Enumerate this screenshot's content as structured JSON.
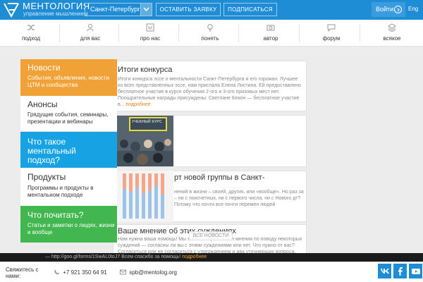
{
  "header": {
    "brand": "МЕНТОЛОГИЯ",
    "tagline": "управление мышлением",
    "city": "Санкт-Петербург",
    "apply_label": "ОСТАВИТЬ ЗАЯВКУ",
    "subscribe_label": "ПОДПИСАТЬСЯ",
    "login_label": "Войти",
    "lang_label": "Eng"
  },
  "nav": {
    "items": [
      {
        "label": "подход",
        "icon": "shuffle-icon"
      },
      {
        "label": "для вас",
        "icon": "person-icon"
      },
      {
        "label": "про нас",
        "icon": "m-box-icon"
      },
      {
        "label": "понять",
        "icon": "lightbulb-icon"
      },
      {
        "label": "автор",
        "icon": "camera-icon"
      },
      {
        "label": "форум",
        "icon": "chat-icon"
      },
      {
        "label": "всякое",
        "icon": "layers-icon"
      }
    ]
  },
  "menu": {
    "items": [
      {
        "title": "Новости",
        "subtitle": "События, объявления, новости ЦТМ и сообщества",
        "color": "#f0a236"
      },
      {
        "title": "Анонсы",
        "subtitle": "Грядущие события, семинары, презентации и вебинары",
        "color": "#ffffff"
      },
      {
        "title": "Что такое ментальный подход?",
        "subtitle": "",
        "color": "#17a3e3"
      },
      {
        "title": "Продукты",
        "subtitle": "Программы и продукты в ментальном подходе",
        "color": "#ffffff"
      },
      {
        "title": "Что почитать?",
        "subtitle": "Статьи и заметки о людях, жизни и вообще",
        "color": "#43b74f"
      }
    ]
  },
  "news": [
    {
      "title": "Итоги конкурса",
      "text": "Итоги конкурса эссе о ментальности Санкт-Петербурга и его горожан. Лучшее из всех представленных эссе, нам прислала Елена Листина. Ей предоставлено бесплатное участие в курсе обучения 2-ого и 3-ого призовых мест нет. Поощрительные награды присуждены: Светлане Бекон — бесплатное участие в...",
      "more": "подробнее"
    },
    {
      "title": "",
      "text": "",
      "more": "",
      "photo_caption": "УЧЕБНЫЙ КУРС"
    },
    {
      "title": "рт новой группы в Санкт-",
      "text": "нений в жизни – своей, других, или «вообще». Но раз за – ни с поисчетных, ни с первого числа, ни с Нового дт? Потому что почти все почти перемен людей",
      "more": ""
    },
    {
      "title": "Ваше мнение об этих суждениях",
      "text": "Нам нужна ваша помощь! Мы хотим собрать ваши мнения по поводу некоторых суждений — согласны ли вы с этими суждениями или нет. Что нужно от вас? Согласиться или не согласиться с утверждением и два уточняющих вопроса. Ссылка на форму Google",
      "more": ""
    }
  ],
  "all_news_label": "ВСЕ НОВОСТИ",
  "overlay": {
    "text": "— http://goo.gl/forms/1SwAL0toJ7 Всем спасибо за помощь!",
    "more": "подробнее"
  },
  "footer": {
    "contact_label": "Свяжитесь с нами:",
    "phone": "+7 921 350 64 91",
    "email": "spb@mentolog.org",
    "social": [
      "vk-icon",
      "facebook-icon",
      "youtube-icon"
    ]
  },
  "colors": {
    "brand": "#1f8dd6",
    "orange": "#f0a236",
    "blue": "#17a3e3",
    "green": "#43b74f"
  }
}
